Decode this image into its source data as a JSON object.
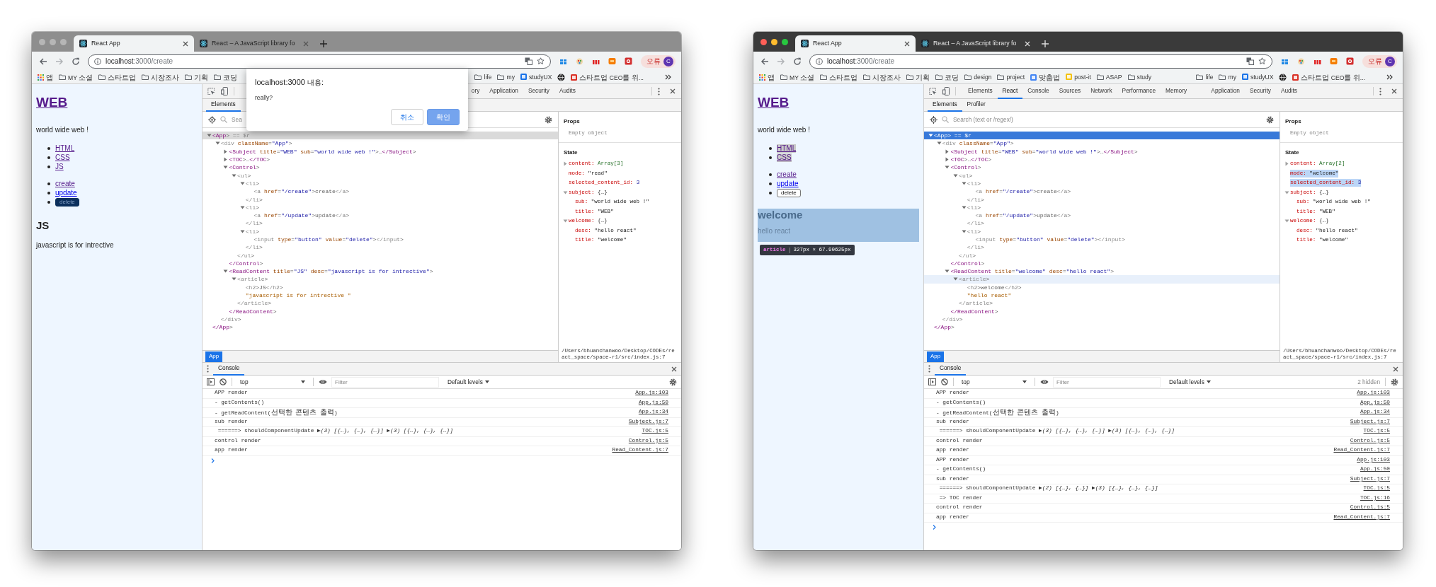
{
  "windows": [
    {
      "active": false,
      "tabs": [
        {
          "title": "React App",
          "selected": true
        },
        {
          "title": "React – A JavaScript library fo",
          "selected": false
        }
      ],
      "address": {
        "host": "localhost",
        "path": ":3000/create"
      },
      "profile": {
        "label": "오류",
        "initial": "C"
      },
      "bookmarks": [
        {
          "kind": "apps",
          "label": "앱"
        },
        {
          "kind": "folder",
          "label": "MY 소셜"
        },
        {
          "kind": "folder",
          "label": "스타트업"
        },
        {
          "kind": "folder",
          "label": "시장조사"
        },
        {
          "kind": "folder",
          "label": "기획"
        },
        {
          "kind": "folder",
          "label": "코딩"
        }
      ],
      "bookmarks_right": [
        {
          "kind": "folder",
          "label": "life"
        },
        {
          "kind": "folder",
          "label": "my"
        },
        {
          "kind": "site",
          "label": "studyUX",
          "color": "#1a73e8"
        },
        {
          "kind": "globe"
        },
        {
          "kind": "site",
          "label": "스타트업 CEO를 위...",
          "color": "#d93025"
        }
      ],
      "page": {
        "title": "WEB",
        "subtitle": "world wide web !",
        "toc": [
          {
            "label": "HTML",
            "visited": true,
            "highlighted": false
          },
          {
            "label": "CSS",
            "visited": true,
            "highlighted": false
          },
          {
            "label": "JS",
            "visited": true,
            "highlighted": false
          }
        ],
        "controls": [
          {
            "kind": "link",
            "label": "create",
            "visited": true
          },
          {
            "kind": "link",
            "label": "update",
            "visited": false
          },
          {
            "kind": "button",
            "label": "delete",
            "focused": true
          }
        ],
        "article": {
          "title": "JS",
          "desc": "javascript is for intrective",
          "inspected": false
        }
      },
      "devtools": {
        "focused": false,
        "tabs_right": [
          {
            "label": "ory",
            "selected": false
          },
          {
            "label": "Application",
            "selected": false
          },
          {
            "label": "Security",
            "selected": false
          },
          {
            "label": "Audits",
            "selected": false
          }
        ],
        "subtabs": [
          {
            "label": "Elements",
            "selected": true
          }
        ],
        "search_placeholder": "Sea",
        "tree": [
          {
            "text": "<App> == $r",
            "expanded": true,
            "selected": true,
            "hovered": false,
            "close": "</App>",
            "children": [
              {
                "text": "<div className=\"App\">",
                "expanded": true,
                "selected": false,
                "hovered": false,
                "close": "</div>",
                "children": [
                  {
                    "text": "<Subject title=\"WEB\" sub=\"world wide web !\">…</Subject>",
                    "expanded": false,
                    "selected": false,
                    "hovered": false
                  },
                  {
                    "text": "<TOC>…</TOC>",
                    "expanded": false,
                    "selected": false,
                    "hovered": false
                  },
                  {
                    "text": "<Control>",
                    "expanded": true,
                    "selected": false,
                    "hovered": false,
                    "close": "</Control>",
                    "children": [
                      {
                        "text": "<ul>",
                        "expanded": true,
                        "selected": false,
                        "hovered": false,
                        "close": "</ul>",
                        "children": [
                          {
                            "text": "<li>",
                            "expanded": true,
                            "selected": false,
                            "hovered": false,
                            "close": "</li>",
                            "children": [
                              {
                                "text": "<a href=\"/create\">create</a>",
                                "selected": false,
                                "hovered": false
                              }
                            ]
                          },
                          {
                            "text": "<li>",
                            "expanded": true,
                            "selected": false,
                            "hovered": false,
                            "close": "</li>",
                            "children": [
                              {
                                "text": "<a href=\"/update\">update</a>",
                                "selected": false,
                                "hovered": false
                              }
                            ]
                          },
                          {
                            "text": "<li>",
                            "expanded": true,
                            "selected": false,
                            "hovered": false,
                            "close": "</li>",
                            "children": [
                              {
                                "text": "<input type=\"button\" value=\"delete\"></input>",
                                "selected": false,
                                "hovered": false
                              }
                            ]
                          }
                        ]
                      }
                    ]
                  },
                  {
                    "text": "<ReadContent title=\"JS\" desc=\"javascript is for intrective\">",
                    "expanded": true,
                    "selected": false,
                    "hovered": false,
                    "close": "</ReadContent>",
                    "children": [
                      {
                        "text": "<article>",
                        "expanded": true,
                        "selected": false,
                        "hovered": false,
                        "close": "</article>",
                        "children": [
                          {
                            "text": "<h2>JS</h2>",
                            "selected": false,
                            "hovered": false
                          },
                          {
                            "text": "\"javascript is for intrective \"",
                            "selected": false,
                            "hovered": false
                          }
                        ]
                      }
                    ]
                  }
                ]
              }
            ]
          }
        ],
        "breadcrumb": "App",
        "props_title": "Props",
        "props_empty": "Empty object",
        "state_title": "State",
        "state": [
          {
            "key": "content:",
            "value": "Array[3]",
            "kind": "array",
            "expanded": false,
            "highlighted": false
          },
          {
            "key": "mode:",
            "value": "\"read\"",
            "kind": "string",
            "highlighted": false
          },
          {
            "key": "selected_content_id:",
            "value": "3",
            "kind": "number",
            "highlighted": false
          },
          {
            "key": "subject:",
            "value": "{…}",
            "kind": "object",
            "expanded": true,
            "highlighted": false,
            "children": [
              {
                "key": "sub:",
                "value": "\"world wide web !\"",
                "kind": "string",
                "highlighted": false
              },
              {
                "key": "title:",
                "value": "\"WEB\"",
                "kind": "string",
                "highlighted": false
              }
            ]
          },
          {
            "key": "welcome:",
            "value": "{…}",
            "kind": "object",
            "expanded": true,
            "highlighted": false,
            "children": [
              {
                "key": "desc:",
                "value": "\"hello react\"",
                "kind": "string",
                "highlighted": false
              },
              {
                "key": "title:",
                "value": "\"welcome\"",
                "kind": "string",
                "highlighted": false
              }
            ]
          }
        ],
        "source_path": "/Users/bhuanchanwoo/Desktop/CODEs/react_space/space-r1/src/index.js:7"
      },
      "console": {
        "tab": "Console",
        "context": "top",
        "filter_placeholder": "Filter",
        "levels": "Default levels",
        "messages": [
          {
            "text": "APP render",
            "source": "App.js:103"
          },
          {
            "text": "- getContents()",
            "source": "App.js:50"
          },
          {
            "text": "- getReadContent(선택한 콘텐츠 출력)",
            "source": "App.js:34"
          },
          {
            "text": "sub render",
            "source": "Subject.js:7"
          },
          {
            "text": " ======> shouldComponentUpdate ▶*(3) [{…}, {…}, {…}]* ▶*(3) [{…}, {…}, {…}]*",
            "source": "TOC.js:5"
          },
          {
            "text": "control render",
            "source": "Control.js:5"
          },
          {
            "text": "app render",
            "source": "Read_Content.js:7"
          }
        ]
      },
      "dialog": {
        "title": "localhost:3000 내용:",
        "message": "really?",
        "buttons": [
          {
            "label": "취소",
            "kind": "secondary"
          },
          {
            "label": "확인",
            "kind": "primary"
          }
        ]
      }
    },
    {
      "active": true,
      "tabs": [
        {
          "title": "React App",
          "selected": true
        },
        {
          "title": "React – A JavaScript library fo",
          "selected": false
        }
      ],
      "address": {
        "host": "localhost",
        "path": ":3000/create"
      },
      "profile": {
        "label": "오류",
        "initial": "C"
      },
      "bookmarks": [
        {
          "kind": "apps",
          "label": "앱"
        },
        {
          "kind": "folder",
          "label": "MY 소셜"
        },
        {
          "kind": "folder",
          "label": "스타트업"
        },
        {
          "kind": "folder",
          "label": "시장조사"
        },
        {
          "kind": "folder",
          "label": "기획"
        },
        {
          "kind": "folder",
          "label": "코딩"
        },
        {
          "kind": "folder",
          "label": "design"
        },
        {
          "kind": "folder",
          "label": "project"
        },
        {
          "kind": "site",
          "label": "맞춤법",
          "color": "#4285f4"
        },
        {
          "kind": "site",
          "label": "post-it",
          "color": "#f4c20d"
        },
        {
          "kind": "folder",
          "label": "ASAP"
        },
        {
          "kind": "folder",
          "label": "study"
        }
      ],
      "bookmarks_right": [
        {
          "kind": "folder",
          "label": "life"
        },
        {
          "kind": "folder",
          "label": "my"
        },
        {
          "kind": "site",
          "label": "studyUX",
          "color": "#1a73e8"
        },
        {
          "kind": "globe"
        },
        {
          "kind": "site",
          "label": "스타트업 CEO를 위...",
          "color": "#d93025"
        }
      ],
      "page": {
        "title": "WEB",
        "subtitle": "world wide web !",
        "toc": [
          {
            "label": "HTML",
            "visited": true,
            "highlighted": true
          },
          {
            "label": "CSS",
            "visited": true,
            "highlighted": true
          }
        ],
        "controls": [
          {
            "kind": "link",
            "label": "create",
            "visited": true
          },
          {
            "kind": "link",
            "label": "update",
            "visited": false
          },
          {
            "kind": "button",
            "label": "delete",
            "focused": false
          }
        ],
        "article": {
          "title": "welcome",
          "desc": "hello react",
          "inspected": true,
          "tooltip": {
            "tag": "article",
            "size": "327px × 67.90625px"
          }
        }
      },
      "devtools": {
        "focused": true,
        "tabs": [
          {
            "label": "Elements",
            "selected": false
          },
          {
            "label": "React",
            "selected": true
          },
          {
            "label": "Console",
            "selected": false
          },
          {
            "label": "Sources",
            "selected": false
          },
          {
            "label": "Network",
            "selected": false
          },
          {
            "label": "Performance",
            "selected": false
          },
          {
            "label": "Memory",
            "selected": false
          }
        ],
        "tabs_right": [
          {
            "label": "Application",
            "selected": false
          },
          {
            "label": "Security",
            "selected": false
          },
          {
            "label": "Audits",
            "selected": false
          }
        ],
        "subtabs": [
          {
            "label": "Elements",
            "selected": true
          },
          {
            "label": "Profiler",
            "selected": false
          }
        ],
        "search_placeholder": "Search (text or /regex/)",
        "tree": [
          {
            "text": "<App> == $r",
            "expanded": true,
            "selected": true,
            "hovered": false,
            "close": "</App>",
            "children": [
              {
                "text": "<div className=\"App\">",
                "expanded": true,
                "selected": false,
                "hovered": false,
                "close": "</div>",
                "children": [
                  {
                    "text": "<Subject title=\"WEB\" sub=\"world wide web !\">…</Subject>",
                    "expanded": false,
                    "selected": false,
                    "hovered": false
                  },
                  {
                    "text": "<TOC>…</TOC>",
                    "expanded": false,
                    "selected": false,
                    "hovered": false
                  },
                  {
                    "text": "<Control>",
                    "expanded": true,
                    "selected": false,
                    "hovered": false,
                    "close": "</Control>",
                    "children": [
                      {
                        "text": "<ul>",
                        "expanded": true,
                        "selected": false,
                        "hovered": false,
                        "close": "</ul>",
                        "children": [
                          {
                            "text": "<li>",
                            "expanded": true,
                            "selected": false,
                            "hovered": false,
                            "close": "</li>",
                            "children": [
                              {
                                "text": "<a href=\"/create\">create</a>",
                                "selected": false,
                                "hovered": false
                              }
                            ]
                          },
                          {
                            "text": "<li>",
                            "expanded": true,
                            "selected": false,
                            "hovered": false,
                            "close": "</li>",
                            "children": [
                              {
                                "text": "<a href=\"/update\">update</a>",
                                "selected": false,
                                "hovered": false
                              }
                            ]
                          },
                          {
                            "text": "<li>",
                            "expanded": true,
                            "selected": false,
                            "hovered": false,
                            "close": "</li>",
                            "children": [
                              {
                                "text": "<input type=\"button\" value=\"delete\"></input>",
                                "selected": false,
                                "hovered": false
                              }
                            ]
                          }
                        ]
                      }
                    ]
                  },
                  {
                    "text": "<ReadContent title=\"welcome\" desc=\"hello react\">",
                    "expanded": true,
                    "selected": false,
                    "hovered": false,
                    "close": "</ReadContent>",
                    "children": [
                      {
                        "text": "<article>",
                        "expanded": true,
                        "selected": false,
                        "hovered": true,
                        "close": "</article>",
                        "children": [
                          {
                            "text": "<h2>welcome</h2>",
                            "selected": false,
                            "hovered": false
                          },
                          {
                            "text": "\"hello react\"",
                            "selected": false,
                            "hovered": false
                          }
                        ]
                      }
                    ]
                  }
                ]
              }
            ]
          }
        ],
        "breadcrumb": "App",
        "props_title": "Props",
        "props_empty": "Empty object",
        "state_title": "State",
        "state": [
          {
            "key": "content:",
            "value": "Array[2]",
            "kind": "array",
            "expanded": false,
            "highlighted": false
          },
          {
            "key": "mode:",
            "value": "\"welcome\"",
            "kind": "string",
            "highlighted": true
          },
          {
            "key": "selected_content_id:",
            "value": "3",
            "kind": "number",
            "highlighted": true
          },
          {
            "key": "subject:",
            "value": "{…}",
            "kind": "object",
            "expanded": true,
            "highlighted": false,
            "children": [
              {
                "key": "sub:",
                "value": "\"world wide web !\"",
                "kind": "string",
                "highlighted": false
              },
              {
                "key": "title:",
                "value": "\"WEB\"",
                "kind": "string",
                "highlighted": false
              }
            ]
          },
          {
            "key": "welcome:",
            "value": "{…}",
            "kind": "object",
            "expanded": true,
            "highlighted": false,
            "children": [
              {
                "key": "desc:",
                "value": "\"hello react\"",
                "kind": "string",
                "highlighted": false
              },
              {
                "key": "title:",
                "value": "\"welcome\"",
                "kind": "string",
                "highlighted": false
              }
            ]
          }
        ],
        "source_path": "/Users/bhuanchanwoo/Desktop/CODEs/react_space/space-r1/src/index.js:7"
      },
      "console": {
        "tab": "Console",
        "context": "top",
        "filter_placeholder": "Filter",
        "levels": "Default levels",
        "hidden_count": "2 hidden",
        "messages": [
          {
            "text": "APP render",
            "source": "App.js:103"
          },
          {
            "text": "- getContents()",
            "source": "App.js:50"
          },
          {
            "text": "- getReadContent(선택한 콘텐츠 출력)",
            "source": "App.js:34"
          },
          {
            "text": "sub render",
            "source": "Subject.js:7"
          },
          {
            "text": " ======> shouldComponentUpdate ▶*(3) [{…}, {…}, {…}]* ▶*(3) [{…}, {…}, {…}]*",
            "source": "TOC.js:5"
          },
          {
            "text": "control render",
            "source": "Control.js:5"
          },
          {
            "text": "app render",
            "source": "Read_Content.js:7"
          },
          {
            "text": "APP render",
            "source": "App.js:103"
          },
          {
            "text": "- getContents()",
            "source": "App.js:50"
          },
          {
            "text": "sub render",
            "source": "Subject.js:7"
          },
          {
            "text": " ======> shouldComponentUpdate ▶*(2) [{…}, {…}]* ▶*(3) [{…}, {…}, {…}]*",
            "source": "TOC.js:5"
          },
          {
            "text": " => TOC render",
            "source": "TOC.js:16"
          },
          {
            "text": "control render",
            "source": "Control.js:5"
          },
          {
            "text": "app render",
            "source": "Read_Content.js:7"
          }
        ]
      }
    }
  ]
}
